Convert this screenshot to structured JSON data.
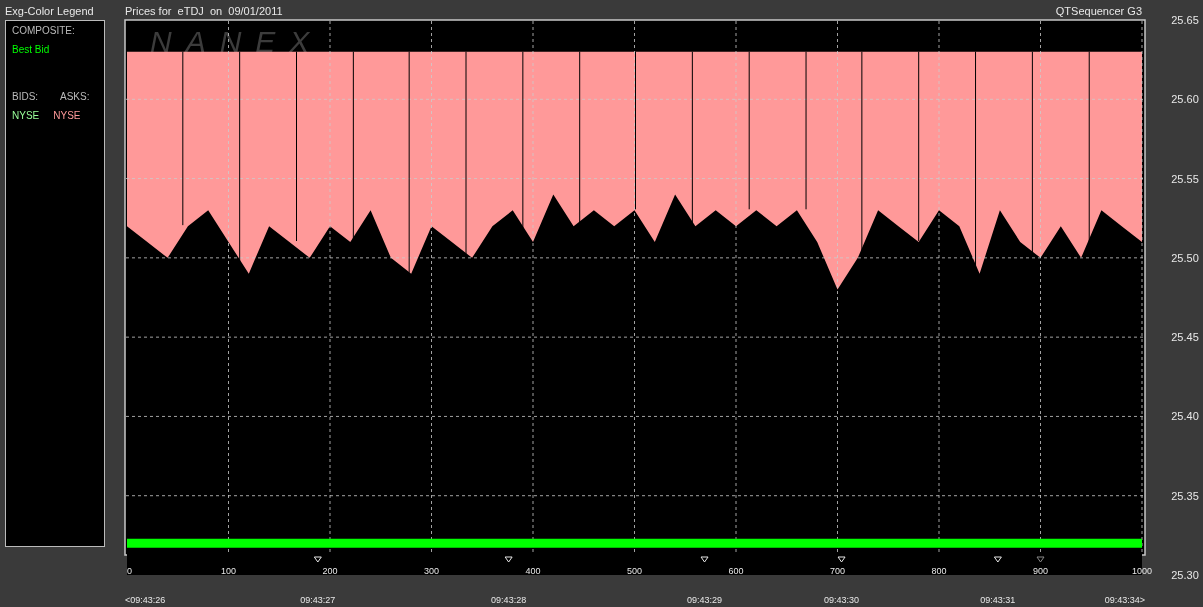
{
  "legend": {
    "title": "Exg-Color Legend",
    "composite_label": "COMPOSITE:",
    "composite": [
      {
        "label": "Best Bid",
        "color": "#00ff00"
      }
    ],
    "bids_label": "BIDS:",
    "asks_label": "ASKS:",
    "bids": [
      {
        "label": "NYSE",
        "color": "#99ff99"
      }
    ],
    "asks": [
      {
        "label": "NYSE",
        "color": "#ff9999"
      }
    ]
  },
  "chart": {
    "title": "Prices for  eTDJ  on  09/01/2011",
    "app_label": "QTSequencer G3",
    "logo_text": "NANEX",
    "chart_data": {
      "type": "area",
      "xlim": [
        0,
        1000
      ],
      "ylim": [
        25.3,
        25.65
      ],
      "xticks": [
        0,
        100,
        200,
        300,
        400,
        500,
        600,
        700,
        800,
        900,
        1000
      ],
      "yticks": [
        {
          "value": 25.3,
          "label": "25.30"
        },
        {
          "value": 25.35,
          "label": "25.35"
        },
        {
          "value": 25.4,
          "label": "25.40"
        },
        {
          "value": 25.45,
          "label": "25.45"
        },
        {
          "value": 25.5,
          "label": "25.50"
        },
        {
          "value": 25.55,
          "label": "25.55"
        },
        {
          "value": 25.6,
          "label": "25.60"
        },
        {
          "value": 25.65,
          "label": "25.65"
        }
      ],
      "x": [
        0,
        20,
        40,
        60,
        80,
        100,
        120,
        140,
        160,
        180,
        200,
        220,
        240,
        260,
        280,
        300,
        320,
        340,
        360,
        380,
        400,
        420,
        440,
        460,
        480,
        500,
        520,
        540,
        560,
        580,
        600,
        620,
        640,
        660,
        680,
        700,
        720,
        740,
        760,
        780,
        800,
        820,
        840,
        860,
        880,
        900,
        920,
        940,
        960,
        980,
        1000
      ],
      "grid": true,
      "series": [
        {
          "type": "area",
          "color": "#ff9999",
          "values": [
            25.63,
            25.63,
            25.63,
            25.63,
            25.63,
            25.63,
            25.63,
            25.63,
            25.63,
            25.63,
            25.63,
            25.63,
            25.63,
            25.63,
            25.63,
            25.63,
            25.63,
            25.63,
            25.63,
            25.63,
            25.63,
            25.63,
            25.63,
            25.63,
            25.63,
            25.63,
            25.63,
            25.63,
            25.63,
            25.63,
            25.63,
            25.63,
            25.63,
            25.63,
            25.63,
            25.63,
            25.63,
            25.63,
            25.63,
            25.63,
            25.63,
            25.63,
            25.63,
            25.63,
            25.63,
            25.63,
            25.63,
            25.63,
            25.63,
            25.63,
            25.63
          ]
        },
        {
          "type": "area",
          "color": "#000000",
          "values": [
            25.52,
            25.51,
            25.5,
            25.52,
            25.53,
            25.51,
            25.49,
            25.52,
            25.51,
            25.5,
            25.52,
            25.51,
            25.53,
            25.5,
            25.49,
            25.52,
            25.51,
            25.5,
            25.52,
            25.53,
            25.51,
            25.54,
            25.52,
            25.53,
            25.52,
            25.53,
            25.51,
            25.54,
            25.52,
            25.53,
            25.52,
            25.53,
            25.52,
            25.53,
            25.51,
            25.48,
            25.5,
            25.53,
            25.52,
            25.51,
            25.53,
            25.52,
            25.49,
            25.53,
            25.51,
            25.5,
            25.52,
            25.5,
            25.53,
            25.52,
            25.51
          ]
        },
        {
          "type": "line",
          "color": "#00ff00",
          "values": [
            25.32,
            25.32,
            25.32,
            25.32,
            25.32,
            25.32,
            25.32,
            25.32,
            25.32,
            25.32,
            25.32,
            25.32,
            25.32,
            25.32,
            25.32,
            25.32,
            25.32,
            25.32,
            25.32,
            25.32,
            25.32,
            25.32,
            25.32,
            25.32,
            25.32,
            25.32,
            25.32,
            25.32,
            25.32,
            25.32,
            25.32,
            25.32,
            25.32,
            25.32,
            25.32,
            25.32,
            25.32,
            25.32,
            25.32,
            25.32,
            25.32,
            25.32,
            25.32,
            25.32,
            25.32,
            25.32,
            25.32,
            25.32,
            25.32,
            25.32,
            25.32
          ]
        }
      ]
    },
    "time_labels": [
      {
        "label": "<09:43:26",
        "kind": "start"
      },
      {
        "label": "09:43:27",
        "kind": "marker"
      },
      {
        "label": "09:43:28",
        "kind": "marker"
      },
      {
        "label": "09:43:29",
        "kind": "marker"
      },
      {
        "label": "09:43:30",
        "kind": "marker"
      },
      {
        "label": "09:43:31",
        "kind": "marker"
      },
      {
        "kind": "faint-marker"
      },
      {
        "label": "09:43:34>",
        "kind": "end"
      }
    ]
  }
}
